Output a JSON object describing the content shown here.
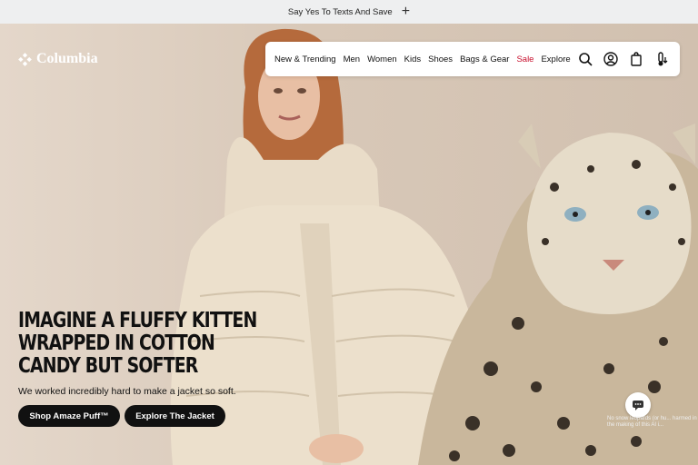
{
  "promo": {
    "text": "Say Yes To Texts And Save"
  },
  "logo": {
    "text": "Columbia"
  },
  "nav": {
    "items": [
      "New & Trending",
      "Men",
      "Women",
      "Kids",
      "Shoes",
      "Bags & Gear",
      "Sale",
      "Explore"
    ],
    "sale_color": "#c8102e"
  },
  "hero": {
    "headline": "Imagine a fluffy kitten wrapped in cotton candy but softer",
    "subtext": "We worked incredibly hard to make a jacket so soft.",
    "buttons": {
      "shop": "Shop Amaze Puff™",
      "explore": "Explore The Jacket"
    },
    "disclaimer": "No snow leopards (or hu... harmed in the making of this AI i..."
  },
  "icons": [
    "plus-icon",
    "columbia-diamond-icon",
    "search-icon",
    "account-icon",
    "bag-icon",
    "temperature-icon",
    "chat-icon"
  ]
}
